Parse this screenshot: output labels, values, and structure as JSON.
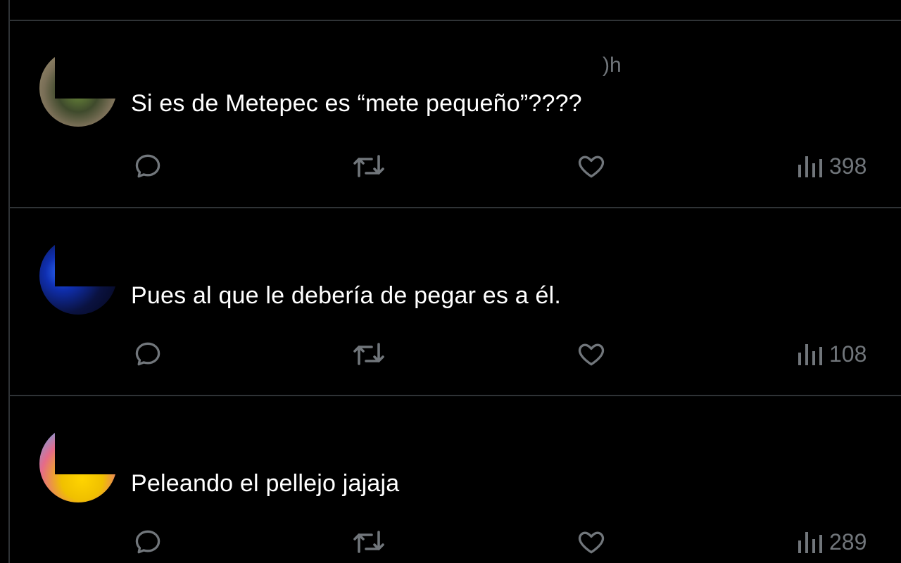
{
  "replies": [
    {
      "time_fragment": ")h",
      "text": "Si es de Metepec es “mete pequeño”????",
      "views": "398",
      "icons": {
        "reply": "reply-icon",
        "retweet": "retweet-icon",
        "like": "like-icon",
        "views": "views-icon"
      }
    },
    {
      "time_fragment": "",
      "text": "Pues al que le debería de pegar es a él.",
      "views": "108",
      "icons": {
        "reply": "reply-icon",
        "retweet": "retweet-icon",
        "like": "like-icon",
        "views": "views-icon"
      }
    },
    {
      "time_fragment": "",
      "text": "Peleando el pellejo jajaja",
      "views": "289",
      "icons": {
        "reply": "reply-icon",
        "retweet": "retweet-icon",
        "like": "like-icon",
        "views": "views-icon"
      }
    }
  ],
  "colors": {
    "background": "#000000",
    "divider": "#2f3336",
    "text": "#ffffff",
    "muted": "#71767b"
  }
}
